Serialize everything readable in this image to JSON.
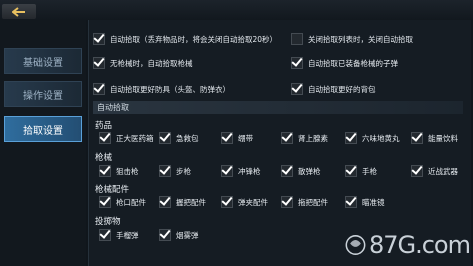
{
  "sidebar": {
    "items": [
      {
        "label": "基础设置",
        "active": false
      },
      {
        "label": "操作设置",
        "active": false
      },
      {
        "label": "拾取设置",
        "active": true
      }
    ]
  },
  "options": {
    "auto_pickup": {
      "label": "自动拾取（丢弃物品时，将会关闭自动拾取20秒）",
      "checked": true
    },
    "close_pickup_list": {
      "label": "关闭拾取列表时，关闭自动拾取",
      "checked": false
    },
    "no_gun_pickup": {
      "label": "无枪械时，自动拾取枪械",
      "checked": true
    },
    "ammo_for_gun": {
      "label": "自动拾取已装备枪械的子弹",
      "checked": true
    },
    "better_armor": {
      "label": "自动拾取更好防具（头盔、防弹衣）",
      "checked": true
    },
    "better_backpack": {
      "label": "自动拾取更好的背包",
      "checked": true
    }
  },
  "auto_section_title": "自动拾取",
  "categories": [
    {
      "title": "药品",
      "items": [
        {
          "label": "正大医药箱",
          "checked": true
        },
        {
          "label": "急救包",
          "checked": true
        },
        {
          "label": "绷带",
          "checked": true
        },
        {
          "label": "肾上腺素",
          "checked": true
        },
        {
          "label": "六味地黄丸",
          "checked": true
        },
        {
          "label": "能量饮料",
          "checked": true
        }
      ]
    },
    {
      "title": "枪械",
      "items": [
        {
          "label": "狙击枪",
          "checked": true
        },
        {
          "label": "步枪",
          "checked": true
        },
        {
          "label": "冲锋枪",
          "checked": true
        },
        {
          "label": "散弹枪",
          "checked": true
        },
        {
          "label": "手枪",
          "checked": true
        },
        {
          "label": "近战武器",
          "checked": true
        }
      ]
    },
    {
      "title": "枪械配件",
      "items": [
        {
          "label": "枪口配件",
          "checked": true
        },
        {
          "label": "握把配件",
          "checked": true
        },
        {
          "label": "弹夹配件",
          "checked": true
        },
        {
          "label": "拖把配件",
          "checked": true
        },
        {
          "label": "瞄准镜",
          "checked": true
        }
      ]
    },
    {
      "title": "投掷物",
      "items": [
        {
          "label": "手榴弹",
          "checked": true
        },
        {
          "label": "烟雾弹",
          "checked": true
        }
      ]
    }
  ],
  "watermark": {
    "text": "87G.com"
  }
}
